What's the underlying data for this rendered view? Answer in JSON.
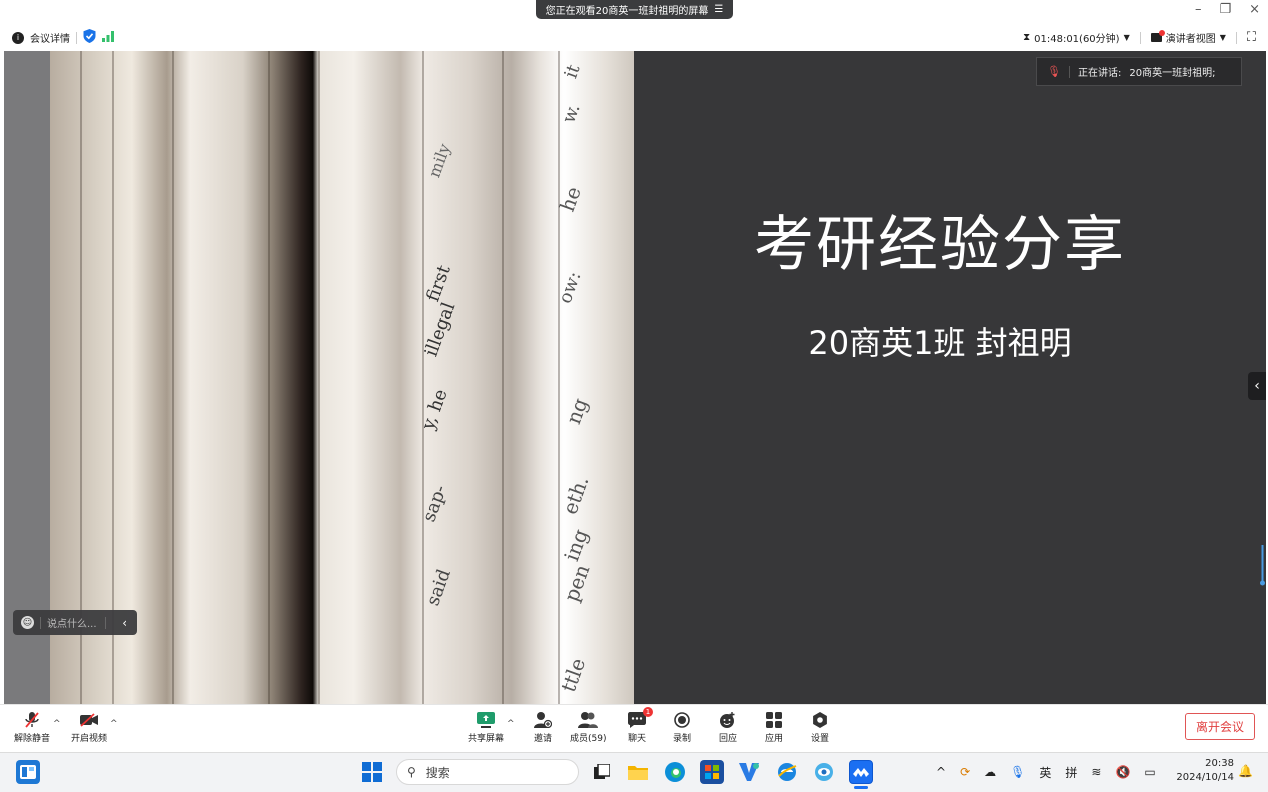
{
  "banner": {
    "text": "您正在观看20商英一班封祖明的屏幕",
    "menu_icon": "list-icon"
  },
  "window_controls": {
    "minimize": "–",
    "restore": "❐",
    "close": "×"
  },
  "info_bar": {
    "meeting_details": "会议详情",
    "timer": "01:48:01(60分钟)",
    "presenter_view": "演讲者视图",
    "icons": [
      "info-icon",
      "shield-icon",
      "signal-icon",
      "hourglass-icon",
      "fullscreen-icon"
    ]
  },
  "stage": {
    "speaking_label": "正在讲话:",
    "speaking_name": "20商英一班封祖明;",
    "slide_title": "考研经验分享",
    "slide_subtitle": "20商英1班 封祖明",
    "chat_placeholder": "说点什么...",
    "book_words": [
      "it",
      "w.",
      "mily",
      "he",
      "ow:",
      "first",
      "illegal",
      "ng",
      "y, he",
      "eth.",
      "sap-",
      "ing",
      "said",
      "pen",
      "ttle"
    ]
  },
  "toolbar": {
    "unmute": "解除静音",
    "start_video": "开启视频",
    "share_screen": "共享屏幕",
    "invite": "邀请",
    "members": "成员(59)",
    "chat": "聊天",
    "chat_badge": "1",
    "record": "录制",
    "reactions": "回应",
    "apps": "应用",
    "settings": "设置",
    "leave": "离开会议"
  },
  "taskbar": {
    "search_placeholder": "搜索",
    "ime_lang": "英",
    "ime_mode": "拼",
    "time": "20:38",
    "date": "2024/10/14"
  },
  "colors": {
    "accent": "#1a73e8",
    "leave_red": "#e04040",
    "stage_bg": "#373739",
    "chat_badge": "#e33333"
  }
}
